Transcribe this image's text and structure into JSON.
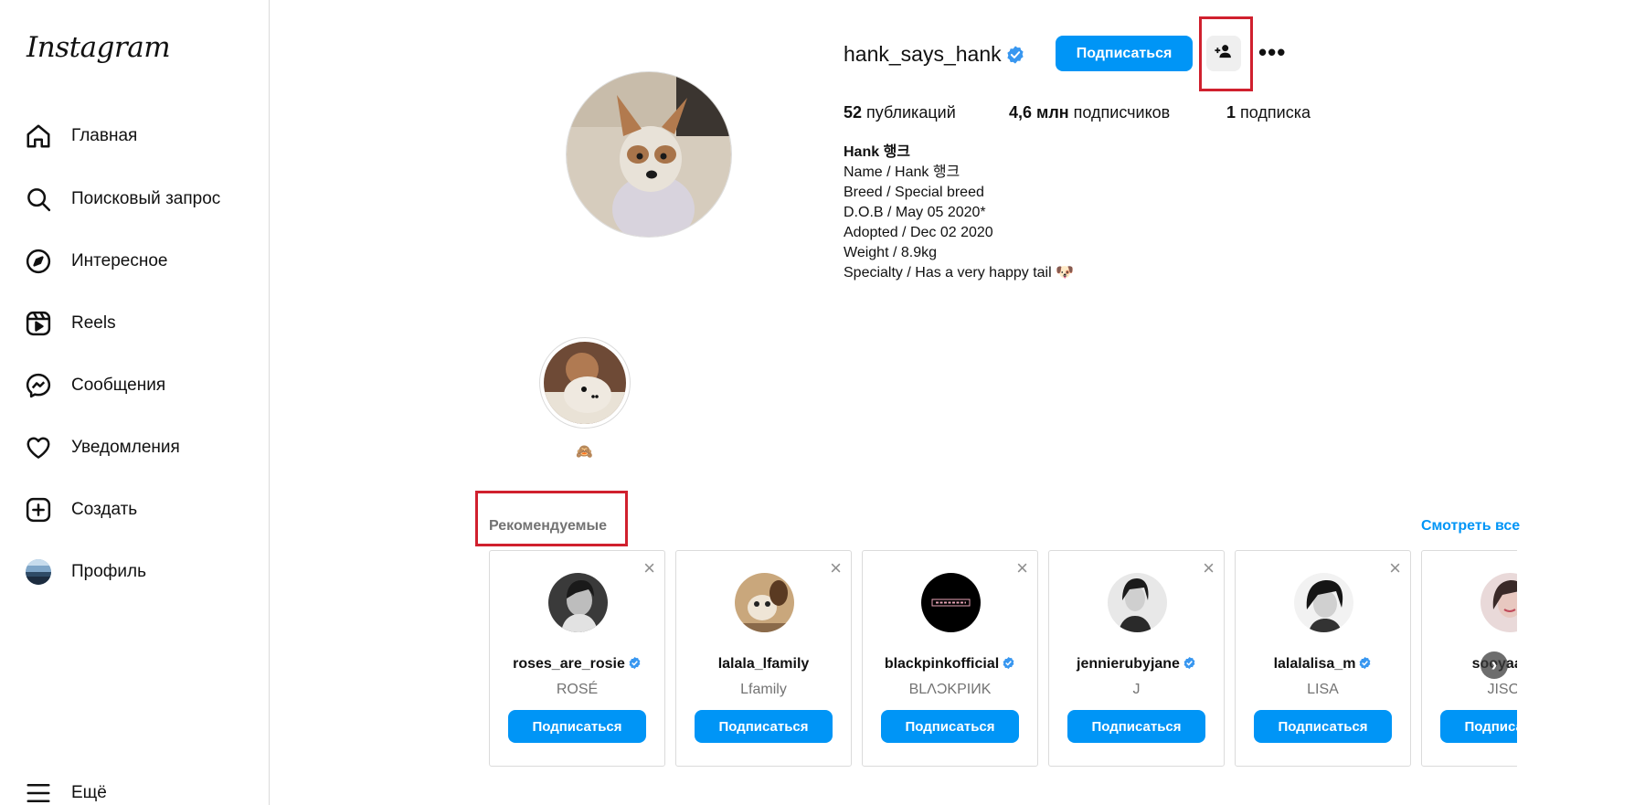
{
  "app": {
    "logo": "Instagram"
  },
  "sidebar": {
    "items": [
      {
        "label": "Главная",
        "icon": "home-icon"
      },
      {
        "label": "Поисковый запрос",
        "icon": "search-icon"
      },
      {
        "label": "Интересное",
        "icon": "compass-icon"
      },
      {
        "label": "Reels",
        "icon": "reels-icon"
      },
      {
        "label": "Сообщения",
        "icon": "messenger-icon"
      },
      {
        "label": "Уведомления",
        "icon": "heart-icon"
      },
      {
        "label": "Создать",
        "icon": "plus-square-icon"
      },
      {
        "label": "Профиль",
        "icon": "profile-avatar"
      }
    ],
    "more_label": "Ещё"
  },
  "profile": {
    "username": "hank_says_hank",
    "verified": true,
    "follow_label": "Подписаться",
    "stats": {
      "posts_count": "52",
      "posts_label": "публикаций",
      "followers_count": "4,6 млн",
      "followers_label": "подписчиков",
      "following_count": "1",
      "following_label": "подписка"
    },
    "bio": {
      "name": "Hank 행크",
      "lines": [
        "Name / Hank 행크",
        "Breed / Special breed",
        "D.O.B / May 05 2020*",
        "Adopted / Dec 02 2020",
        "Weight / 8.9kg",
        "Specialty / Has a very happy tail 🐶"
      ]
    }
  },
  "highlights": [
    {
      "label": "🙈"
    }
  ],
  "suggested": {
    "title": "Рекомендуемые",
    "see_all": "Смотреть все",
    "follow_label": "Подписаться",
    "cards": [
      {
        "username": "roses_are_rosie",
        "full_name": "ROSÉ",
        "verified": true
      },
      {
        "username": "lalala_lfamily",
        "full_name": "Lfamily",
        "verified": false
      },
      {
        "username": "blackpinkofficial",
        "full_name": "BLΛƆKPIИK",
        "verified": true
      },
      {
        "username": "jennierubyjane",
        "full_name": "J",
        "verified": true
      },
      {
        "username": "lalalalisa_m",
        "full_name": "LISA",
        "verified": true
      },
      {
        "username": "sooyaaa__",
        "full_name": "JISOO",
        "verified": true
      }
    ]
  },
  "colors": {
    "accent": "#0095f6",
    "highlight_box": "#d0202e",
    "muted_text": "#737373"
  }
}
